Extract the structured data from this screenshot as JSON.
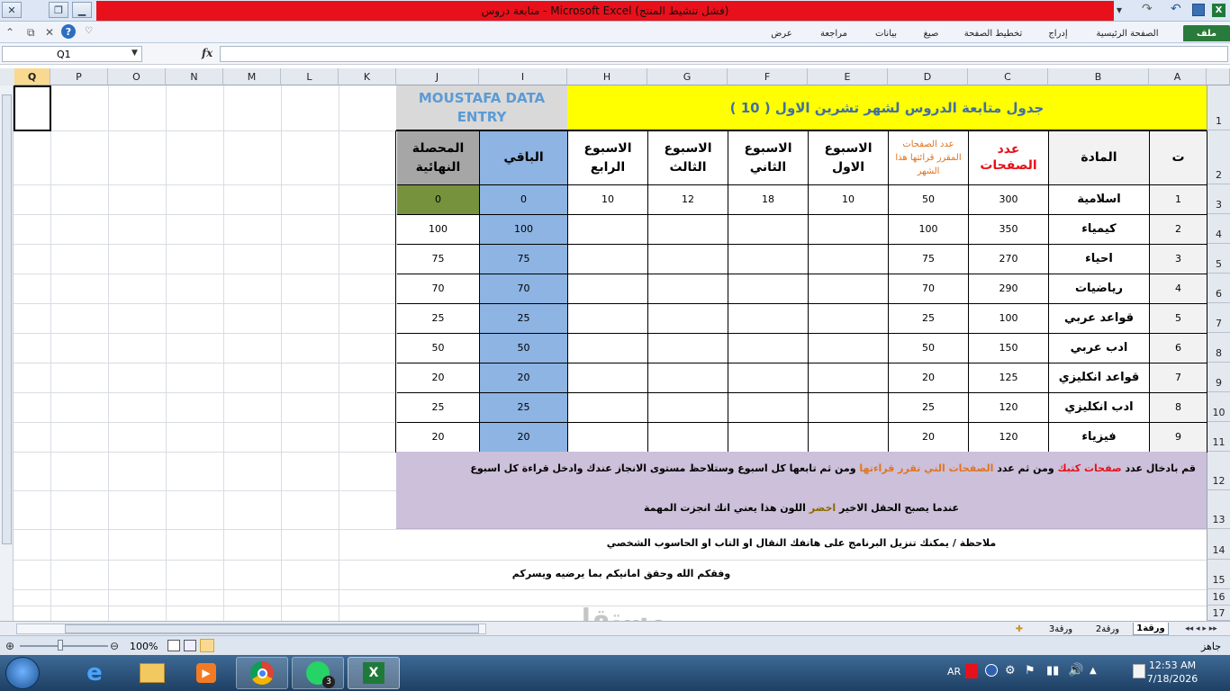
{
  "window": {
    "title": "متابعة دروس  -  Microsoft Excel (فشل تنشيط المنتج)"
  },
  "ribbon": {
    "tabs": [
      "ملف",
      "الصفحة الرئيسية",
      "إدراج",
      "تخطيط الصفحة",
      "صيغ",
      "بيانات",
      "مراجعة",
      "عرض"
    ]
  },
  "formula_bar": {
    "name_box": "Q1",
    "fx": "fx",
    "content": ""
  },
  "columns": [
    "A",
    "B",
    "C",
    "D",
    "E",
    "F",
    "G",
    "H",
    "I",
    "J",
    "K",
    "L",
    "M",
    "N",
    "O",
    "P",
    "Q"
  ],
  "rows": [
    "1",
    "2",
    "3",
    "4",
    "5",
    "6",
    "7",
    "8",
    "9",
    "10",
    "11",
    "12",
    "13",
    "14",
    "15",
    "16",
    "17"
  ],
  "sheet": {
    "title": "جدول متابعة الدروس لشهر تشرين الاول ( 10 )",
    "brand": "MOUSTAFA DATA ENTRY",
    "headers": {
      "num": "ت",
      "subject": "المادة",
      "pages": "عدد الصفحات",
      "monthly": "عدد الصفحات المقرر قرائتها هذا الشهر",
      "week1": "الاسبوع الاول",
      "week2": "الاسبوع الثاني",
      "week3": "الاسبوع الثالث",
      "week4": "الاسبوع الرابع",
      "remaining": "الباقي",
      "final": "المحصلة النهائية"
    },
    "rows": [
      {
        "num": "1",
        "subject": "اسلامية",
        "pages": "300",
        "monthly": "50",
        "w1": "10",
        "w2": "18",
        "w3": "12",
        "w4": "10",
        "remaining": "0",
        "final": "0"
      },
      {
        "num": "2",
        "subject": "كيمياء",
        "pages": "350",
        "monthly": "100",
        "w1": "",
        "w2": "",
        "w3": "",
        "w4": "",
        "remaining": "100",
        "final": "100"
      },
      {
        "num": "3",
        "subject": "احياء",
        "pages": "270",
        "monthly": "75",
        "w1": "",
        "w2": "",
        "w3": "",
        "w4": "",
        "remaining": "75",
        "final": "75"
      },
      {
        "num": "4",
        "subject": "رياضيات",
        "pages": "290",
        "monthly": "70",
        "w1": "",
        "w2": "",
        "w3": "",
        "w4": "",
        "remaining": "70",
        "final": "70"
      },
      {
        "num": "5",
        "subject": "قواعد عربي",
        "pages": "100",
        "monthly": "25",
        "w1": "",
        "w2": "",
        "w3": "",
        "w4": "",
        "remaining": "25",
        "final": "25"
      },
      {
        "num": "6",
        "subject": "ادب عربي",
        "pages": "150",
        "monthly": "50",
        "w1": "",
        "w2": "",
        "w3": "",
        "w4": "",
        "remaining": "50",
        "final": "50"
      },
      {
        "num": "7",
        "subject": "قواعد انكليزي",
        "pages": "125",
        "monthly": "20",
        "w1": "",
        "w2": "",
        "w3": "",
        "w4": "",
        "remaining": "20",
        "final": "20"
      },
      {
        "num": "8",
        "subject": "ادب انكليزي",
        "pages": "120",
        "monthly": "25",
        "w1": "",
        "w2": "",
        "w3": "",
        "w4": "",
        "remaining": "25",
        "final": "25"
      },
      {
        "num": "9",
        "subject": "فيزياء",
        "pages": "120",
        "monthly": "20",
        "w1": "",
        "w2": "",
        "w3": "",
        "w4": "",
        "remaining": "20",
        "final": "20"
      }
    ],
    "note1": {
      "a": "قم بادخال عدد",
      "b": "صفحات كتبك",
      "c": "ومن ثم عدد",
      "d": "الصفحات التي تقرر قراءتها",
      "e": "ومن ثم تابعها كل اسبوع وستلاحظ مستوى الانجاز عندك وادخل قراءة كل اسبوع"
    },
    "note2": {
      "a": "عندما يصبح الحقل الاخير",
      "b": "اخضر",
      "c": "اللون هذا يعني انك انجزت المهمة"
    },
    "note3": "ملاحظة / يمكنك تنزيل البرنامج على هاتفك النقال او التاب او الحاسوب الشخصي",
    "note4": "وفقكم الله وحقق امانيكم بما يرضيه ويسركم"
  },
  "sheet_tabs": [
    "ورقة1",
    "ورقة2",
    "ورقة3"
  ],
  "status": {
    "ready": "جاهز",
    "zoom": "100%"
  },
  "watermark": {
    "logo": "مستقل",
    "url": "mostaql.com"
  },
  "taskbar": {
    "lang": "AR",
    "time": "12:53 AM",
    "date": "7/18/2026",
    "whatsapp_badge": "3"
  },
  "colors": {
    "final_done": "#76923c",
    "remaining": "#8db4e2",
    "title_bg": "#ffff00",
    "notes_bg": "#ccc0da"
  }
}
